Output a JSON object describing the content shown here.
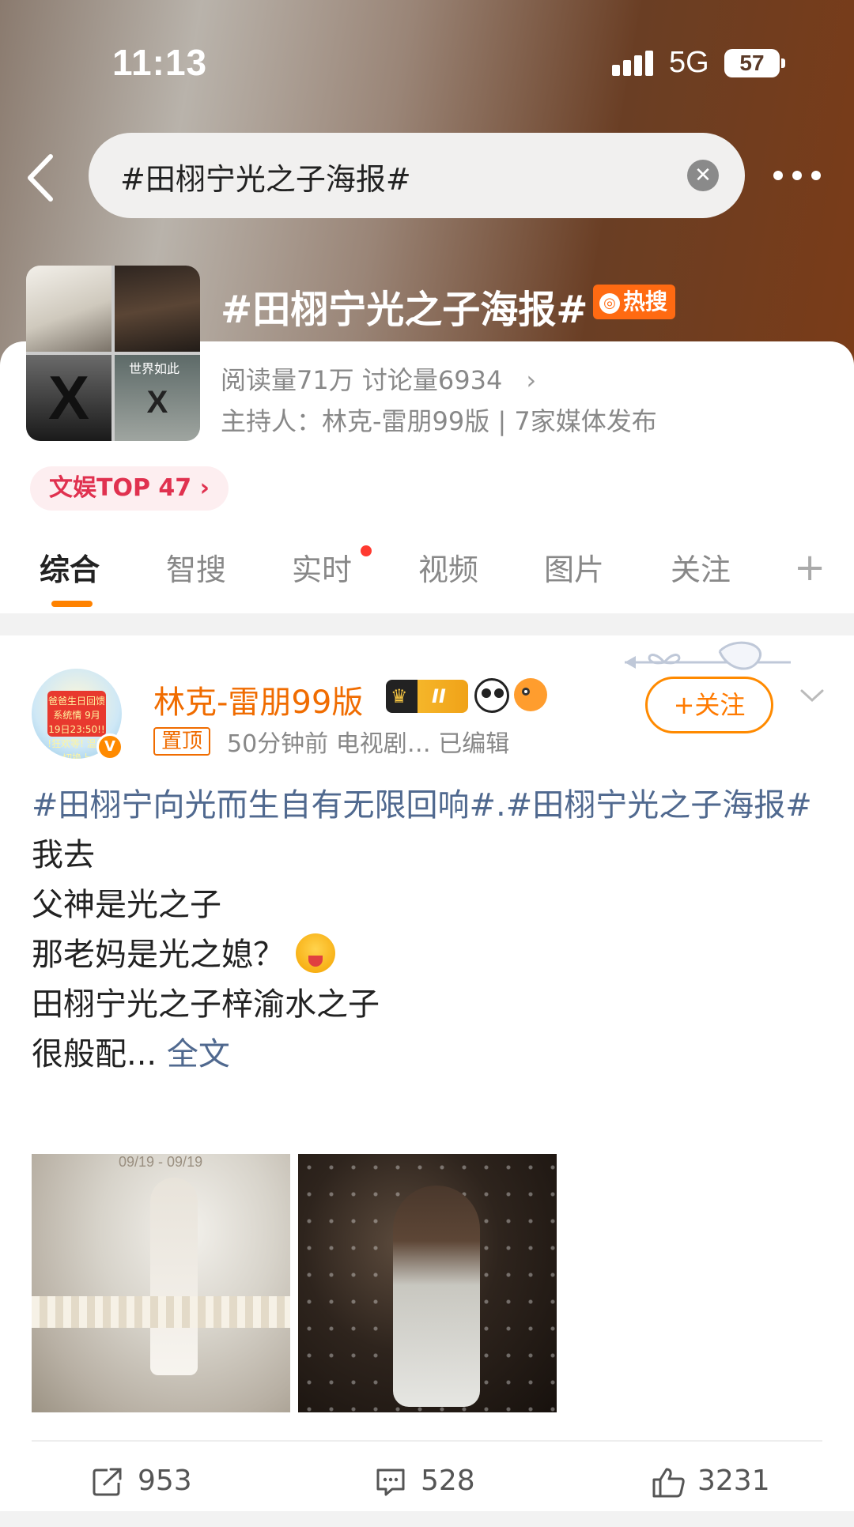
{
  "status_bar": {
    "time": "11:13",
    "network": "5G",
    "battery": "57"
  },
  "search": {
    "query": "#田栩宁光之子海报#",
    "clear_icon": "close-icon"
  },
  "topic": {
    "title": "#田栩宁光之子海报#",
    "hot_label": "热搜",
    "stats": "阅读量71万  讨论量6934",
    "host": "主持人：林克-雷朋99版 | 7家媒体发布",
    "rank": "文娱TOP 47",
    "cover_tile_text": "世界如此",
    "cover_tile_letter": "X"
  },
  "tabs": [
    {
      "label": "综合",
      "active": true
    },
    {
      "label": "智搜",
      "active": false
    },
    {
      "label": "实时",
      "active": false
    },
    {
      "label": "视频",
      "active": false
    },
    {
      "label": "图片",
      "active": false
    },
    {
      "label": "关注",
      "active": false
    }
  ],
  "post": {
    "username": "林克-雷朋99版",
    "vip_level": "II",
    "avatar_text": "爸爸生日回馈 系统情 9月19日23:50!! !狂欢等! 温馨切换上",
    "verified_mark": "V",
    "pinned_label": "置顶",
    "meta": "50分钟前  电视剧…  已编辑",
    "follow_label": "+关注",
    "hashtags": "#田栩宁向光而生自有无限回响#.#田栩宁光之子海报#",
    "lines": [
      "我去",
      "父神是光之子",
      "那老妈是光之媳？",
      "田栩宁光之子梓渝水之子",
      "很般配..."
    ],
    "full_text_link": "全文",
    "photo_caption": "09/19 - 09/19"
  },
  "actions": {
    "repost_count": "953",
    "comment_count": "528",
    "like_count": "3231"
  },
  "colors": {
    "accent_orange": "#ff8200",
    "hashtag_blue": "#50698f",
    "hot_badge": "#ff6a12",
    "rank_red": "#e0314f"
  }
}
